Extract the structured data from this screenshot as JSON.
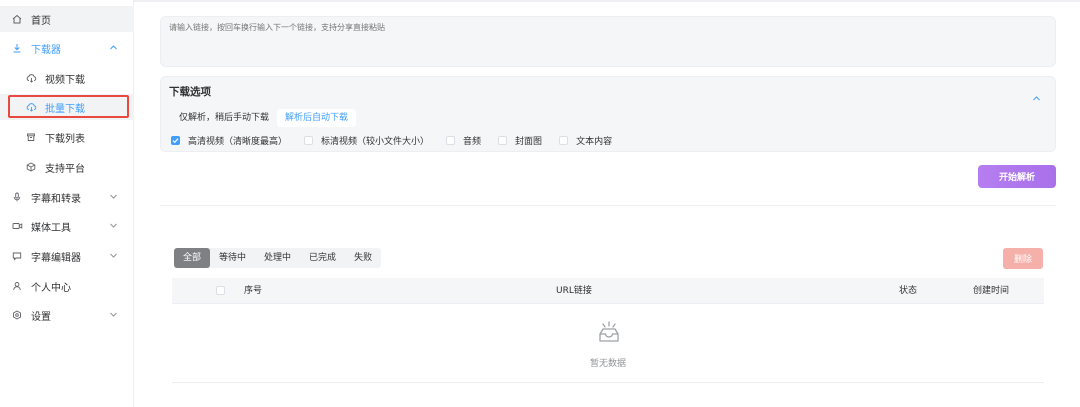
{
  "sidebar": {
    "items": [
      {
        "label": "首页",
        "icon": "home-icon"
      },
      {
        "label": "下载器",
        "icon": "download-icon"
      },
      {
        "label": "视频下载",
        "icon": "cloud-download-icon"
      },
      {
        "label": "批量下载",
        "icon": "cloud-download-icon"
      },
      {
        "label": "下载列表",
        "icon": "archive-icon"
      },
      {
        "label": "支持平台",
        "icon": "cube-icon"
      },
      {
        "label": "字幕和转录",
        "icon": "microphone-icon"
      },
      {
        "label": "媒体工具",
        "icon": "video-camera-icon"
      },
      {
        "label": "字幕编辑器",
        "icon": "subtitle-icon"
      },
      {
        "label": "个人中心",
        "icon": "user-icon"
      },
      {
        "label": "设置",
        "icon": "settings-icon"
      }
    ]
  },
  "main": {
    "url_placeholder": "请输入链接，按回车换行输入下一个链接，支持分享直接粘贴",
    "options": {
      "title": "下载选项",
      "modes": [
        "仅解析，稍后手动下载",
        "解析后自动下载"
      ],
      "active_mode": "解析后自动下载",
      "checkboxes": [
        {
          "label": "高清视频（清晰度最高）",
          "checked": true
        },
        {
          "label": "标清视频（较小文件大小）",
          "checked": false
        },
        {
          "label": "音频",
          "checked": false
        },
        {
          "label": "封面图",
          "checked": false
        },
        {
          "label": "文本内容",
          "checked": false
        }
      ]
    },
    "start_button": "开始解析",
    "filter_tabs": [
      "全部",
      "等待中",
      "处理中",
      "已完成",
      "失败"
    ],
    "active_filter": "全部",
    "delete_button": "删除",
    "table": {
      "columns": [
        "序号",
        "URL链接",
        "状态",
        "创建时间"
      ],
      "empty_text": "暂无数据"
    }
  },
  "colors": {
    "accent": "#409eff",
    "start_button": "#b37feb",
    "delete_button": "#f6b0aa",
    "highlight_box": "#e84a3f"
  }
}
